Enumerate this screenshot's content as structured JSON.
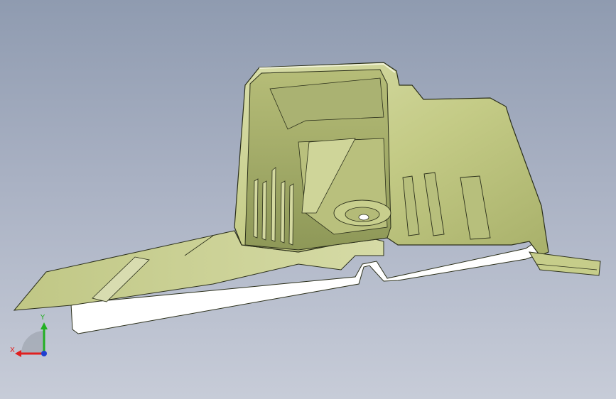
{
  "viewport": {
    "background_top": "#8f9bb0",
    "background_bottom": "#c7ccd8"
  },
  "model": {
    "body_color": "#c9d08e",
    "shade_color": "#9aa562",
    "edge_color": "#2b2f1a",
    "cut_face_color": "#ffffff"
  },
  "triad": {
    "x_label": "X",
    "y_label": "Y",
    "x_color": "#e02020",
    "y_color": "#22b022",
    "z_color": "#2040d0"
  }
}
